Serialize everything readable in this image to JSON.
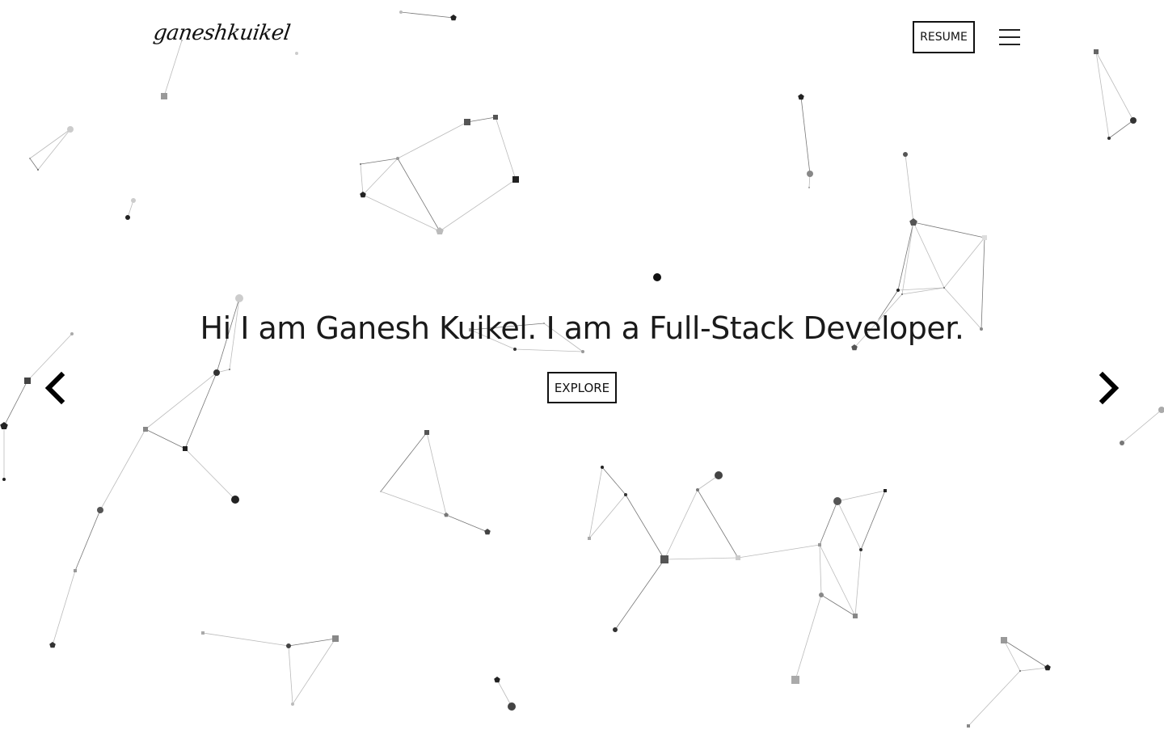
{
  "header": {
    "logo_text": "ganeshkuikel",
    "resume_label": "RESUME",
    "menu_icon": "hamburger-icon"
  },
  "hero": {
    "title": "Hi I am Ganesh Kuikel. I am a Full-Stack Developer.",
    "explore_label": "EXPLORE"
  },
  "carousel": {
    "prev_icon": "chevron-left-icon",
    "next_icon": "chevron-right-icon"
  },
  "theme": {
    "text_color": "#111111",
    "background": "#ffffff",
    "particle_color": "#222222"
  }
}
